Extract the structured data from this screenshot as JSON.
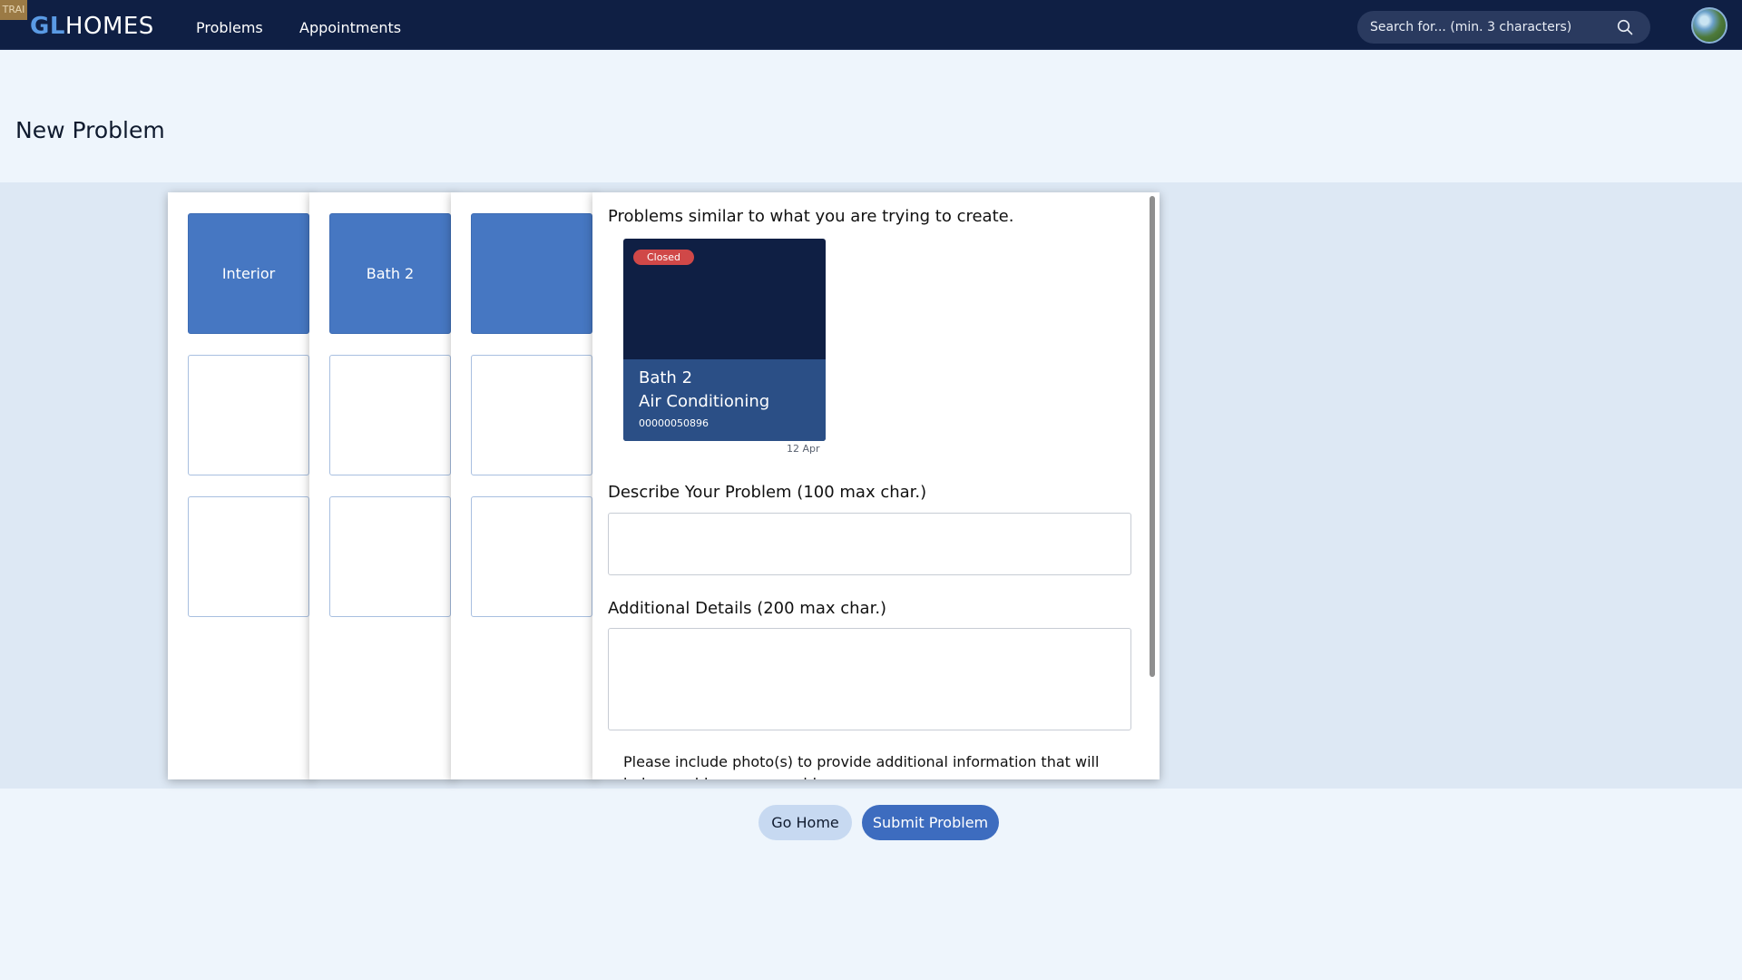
{
  "env_tag": "TRAI",
  "brand": {
    "logo_prefix": "GL",
    "logo_suffix": "HOMES"
  },
  "nav": {
    "problems": "Problems",
    "appointments": "Appointments"
  },
  "search": {
    "placeholder": "Search for... (min. 3 characters)",
    "value": ""
  },
  "page": {
    "title": "New Problem"
  },
  "columns": [
    {
      "selected": "Interior",
      "options": [
        "",
        ""
      ]
    },
    {
      "selected": "Bath 2",
      "options": [
        "",
        ""
      ]
    },
    {
      "selected": "",
      "options": [
        "",
        ""
      ]
    }
  ],
  "form": {
    "similar_heading": "Problems similar to what you are trying to create.",
    "similar_problems": [
      {
        "status": "Closed",
        "location": "Bath 2",
        "category": "Air Conditioning",
        "id": "00000050896",
        "date": "12 Apr"
      }
    ],
    "describe_label": "Describe Your Problem (100 max char.)",
    "describe_value": "",
    "details_label": "Additional Details (200 max char.)",
    "details_value": "",
    "photo_note": "Please include photo(s) to provide additional information that will help us address your problem."
  },
  "buttons": {
    "go_home": "Go Home",
    "submit": "Submit Problem"
  },
  "colors": {
    "navbar": "#0f1f44",
    "accent": "#4677c2",
    "status_closed": "#d04848",
    "card_bottom": "#2b4f86"
  }
}
